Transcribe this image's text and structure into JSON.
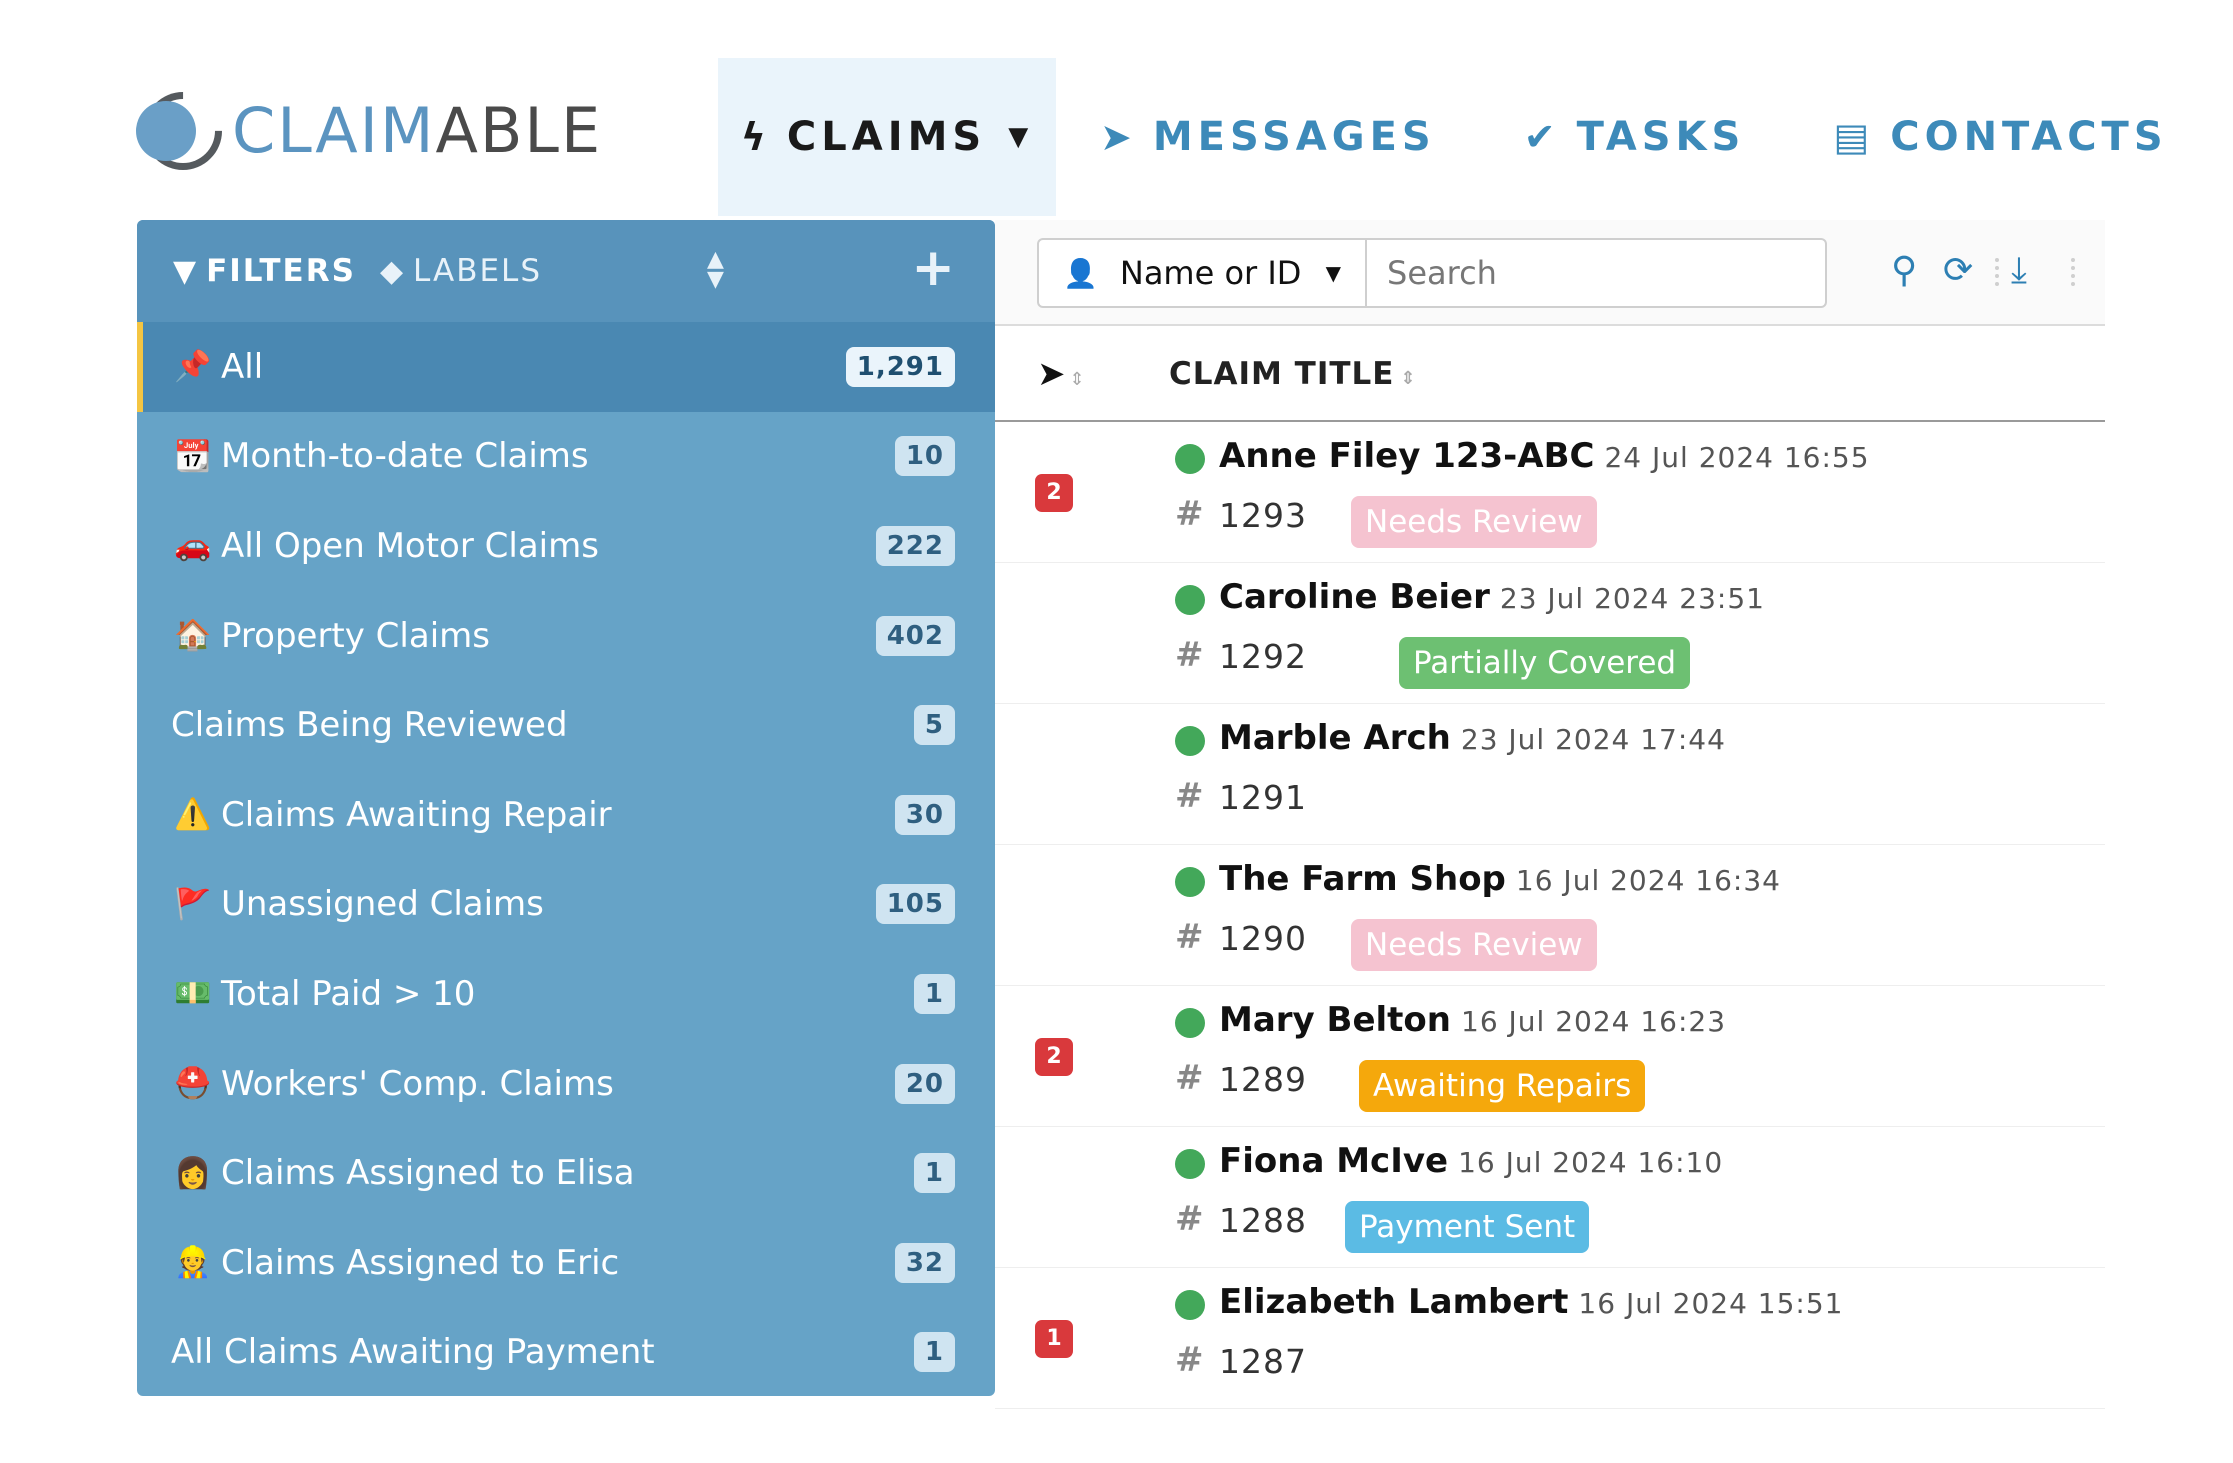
{
  "app": {
    "logo_part1": "CLAIM",
    "logo_part2": "ABLE"
  },
  "nav": [
    {
      "label": "CLAIMS",
      "icon": "bolt-icon",
      "active": true
    },
    {
      "label": "MESSAGES",
      "icon": "paper-plane-icon"
    },
    {
      "label": "TASKS",
      "icon": "check-icon"
    },
    {
      "label": "CONTACTS",
      "icon": "id-card-icon"
    }
  ],
  "sidebar": {
    "filters_label": "FILTERS",
    "labels_label": "LABELS",
    "items": [
      {
        "icon": "pin-icon",
        "emoji": "📌",
        "label": "All",
        "count": "1,291",
        "active": true
      },
      {
        "icon": "calendar-icon",
        "emoji": "📆",
        "label": "Month-to-date Claims",
        "count": "10"
      },
      {
        "icon": "car-icon",
        "emoji": "🚗",
        "label": "All Open Motor Claims",
        "count": "222"
      },
      {
        "icon": "house-icon",
        "emoji": "🏠",
        "label": "Property Claims",
        "count": "402"
      },
      {
        "icon": "",
        "emoji": "",
        "label": "Claims Being Reviewed",
        "count": "5"
      },
      {
        "icon": "warning-icon",
        "emoji": "⚠️",
        "label": "Claims Awaiting Repair",
        "count": "30"
      },
      {
        "icon": "flag-icon",
        "emoji": "🚩",
        "label": "Unassigned Claims",
        "count": "105"
      },
      {
        "icon": "money-icon",
        "emoji": "💵",
        "label": "Total Paid > 10",
        "count": "1"
      },
      {
        "icon": "helmet-icon",
        "emoji": "⛑️",
        "label": "Workers' Comp. Claims",
        "count": "20"
      },
      {
        "icon": "person-icon",
        "emoji": "👩",
        "label": "Claims Assigned to Elisa",
        "count": "1"
      },
      {
        "icon": "person-icon",
        "emoji": "👷",
        "label": "Claims Assigned to Eric",
        "count": "32"
      },
      {
        "icon": "",
        "emoji": "",
        "label": "All Claims Awaiting Payment",
        "count": "1"
      }
    ]
  },
  "toolbar": {
    "select_value": "Name or ID",
    "search_placeholder": "Search"
  },
  "table": {
    "col_title": "CLAIM TITLE",
    "rows": [
      {
        "badge": "2",
        "name": "Anne Filey 123-ABC",
        "date": "24 Jul 2024 16:55",
        "id": "1293",
        "tag": "Needs Review",
        "tag_color": "#f5c3d0"
      },
      {
        "badge": "",
        "name": "Caroline Beier",
        "date": "23 Jul 2024 23:51",
        "id": "1292",
        "tag": "Partially Covered",
        "tag_color": "#6dc072"
      },
      {
        "badge": "",
        "name": "Marble Arch",
        "date": "23 Jul 2024 17:44",
        "id": "1291",
        "tag": "",
        "tag_color": ""
      },
      {
        "badge": "",
        "name": "The Farm Shop",
        "date": "16 Jul 2024 16:34",
        "id": "1290",
        "tag": "Needs Review",
        "tag_color": "#f5c3d0"
      },
      {
        "badge": "2",
        "name": "Mary Belton",
        "date": "16 Jul 2024 16:23",
        "id": "1289",
        "tag": "Awaiting Repairs",
        "tag_color": "#f5a80c"
      },
      {
        "badge": "",
        "name": "Fiona McIve",
        "date": "16 Jul 2024 16:10",
        "id": "1288",
        "tag": "Payment Sent",
        "tag_color": "#5bbbe4"
      },
      {
        "badge": "1",
        "name": "Elizabeth Lambert",
        "date": "16 Jul 2024 15:51",
        "id": "1287",
        "tag": "",
        "tag_color": ""
      }
    ]
  },
  "colors": {
    "accent": "#3d8ab9",
    "sidebar": "#66a3c7",
    "active_marker": "#f4c542",
    "status_dot": "#43a85a",
    "badge": "#d9393c"
  }
}
